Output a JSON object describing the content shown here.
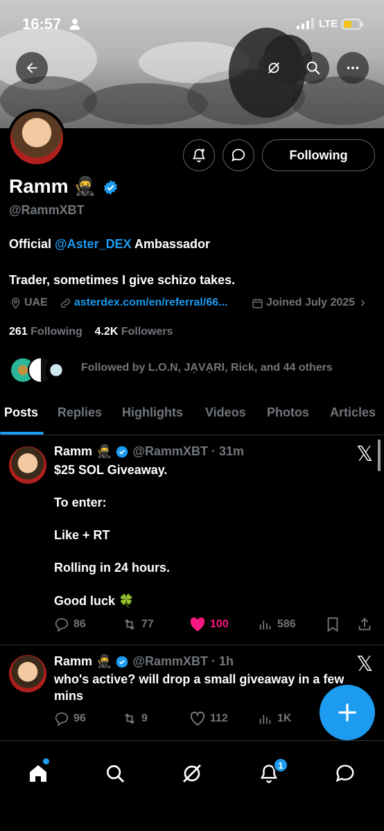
{
  "status": {
    "time": "16:57",
    "network": "LTE"
  },
  "profile": {
    "name": "Ramm",
    "handle": "@RammXBT",
    "bio_prefix": "Official ",
    "bio_mention": "@Aster_DEX",
    "bio_suffix": " Ambassador",
    "bio_line2": "Trader, sometimes I give schizo takes.",
    "location": "UAE",
    "link": "asterdex.com/en/referral/66...",
    "joined": "Joined July 2025",
    "following_count": "261",
    "following_label": "Following",
    "followers_count": "4.2K",
    "followers_label": "Followers",
    "followed_by": "Followed by L.O.N, JẠVẠRI, Rick, and 44 others",
    "follow_button": "Following"
  },
  "tabs": [
    "Posts",
    "Replies",
    "Highlights",
    "Videos",
    "Photos",
    "Articles"
  ],
  "posts": [
    {
      "name": "Ramm",
      "handle": "@RammXBT · 31m",
      "lines": [
        "$25 SOL Giveaway.",
        "To enter:",
        "Like + RT",
        "Rolling in 24 hours.",
        "Good luck 🍀"
      ],
      "replies": "86",
      "reposts": "77",
      "likes": "100",
      "views": "586"
    },
    {
      "name": "Ramm",
      "handle": "@RammXBT · 1h",
      "lines": [
        "who's active? will drop a small giveaway in a few",
        "mins"
      ],
      "replies": "96",
      "reposts": "9",
      "likes": "112",
      "views": "1K"
    }
  ],
  "notifications_badge": "1",
  "colors": {
    "accent": "#1d9bf0",
    "like": "#f91880",
    "muted": "#71767b"
  }
}
